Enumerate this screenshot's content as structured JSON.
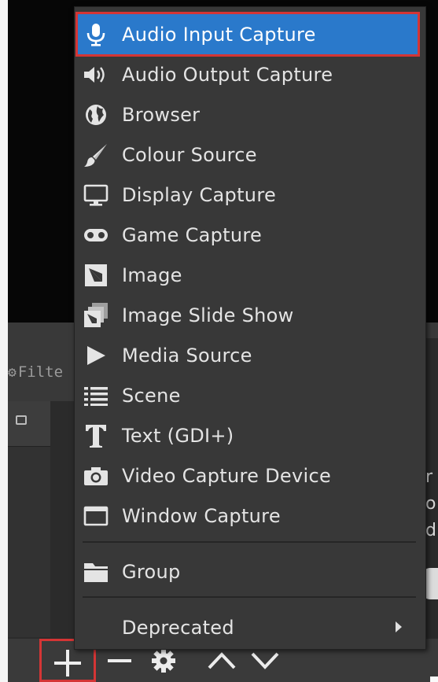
{
  "background": {
    "filters_tab_label": "Filte",
    "right_cut_chars": [
      "r",
      "o",
      "d"
    ]
  },
  "context_menu": {
    "items": [
      {
        "label": "Audio Input Capture",
        "icon": "microphone-icon",
        "selected": true
      },
      {
        "label": "Audio Output Capture",
        "icon": "speaker-icon",
        "selected": false
      },
      {
        "label": "Browser",
        "icon": "globe-icon",
        "selected": false
      },
      {
        "label": "Colour Source",
        "icon": "paintbrush-icon",
        "selected": false
      },
      {
        "label": "Display Capture",
        "icon": "monitor-icon",
        "selected": false
      },
      {
        "label": "Game Capture",
        "icon": "gamepad-icon",
        "selected": false
      },
      {
        "label": "Image",
        "icon": "image-icon",
        "selected": false
      },
      {
        "label": "Image Slide Show",
        "icon": "image-stack-icon",
        "selected": false
      },
      {
        "label": "Media Source",
        "icon": "play-icon",
        "selected": false
      },
      {
        "label": "Scene",
        "icon": "list-icon",
        "selected": false
      },
      {
        "label": "Text (GDI+)",
        "icon": "text-icon",
        "selected": false
      },
      {
        "label": "Video Capture Device",
        "icon": "camera-icon",
        "selected": false
      },
      {
        "label": "Window Capture",
        "icon": "window-icon",
        "selected": false
      }
    ],
    "group_label": "Group",
    "deprecated_label": "Deprecated"
  },
  "toolbar": {
    "add_icon": "plus-icon",
    "remove_icon": "minus-icon",
    "settings_icon": "gear-icon",
    "up_icon": "chevron-up-icon",
    "down_icon": "chevron-down-icon"
  },
  "colors": {
    "highlight": "#2a79cb",
    "callout_border": "#d43535",
    "menu_bg": "#383838",
    "toolbar_bg": "#3a3a3a"
  }
}
